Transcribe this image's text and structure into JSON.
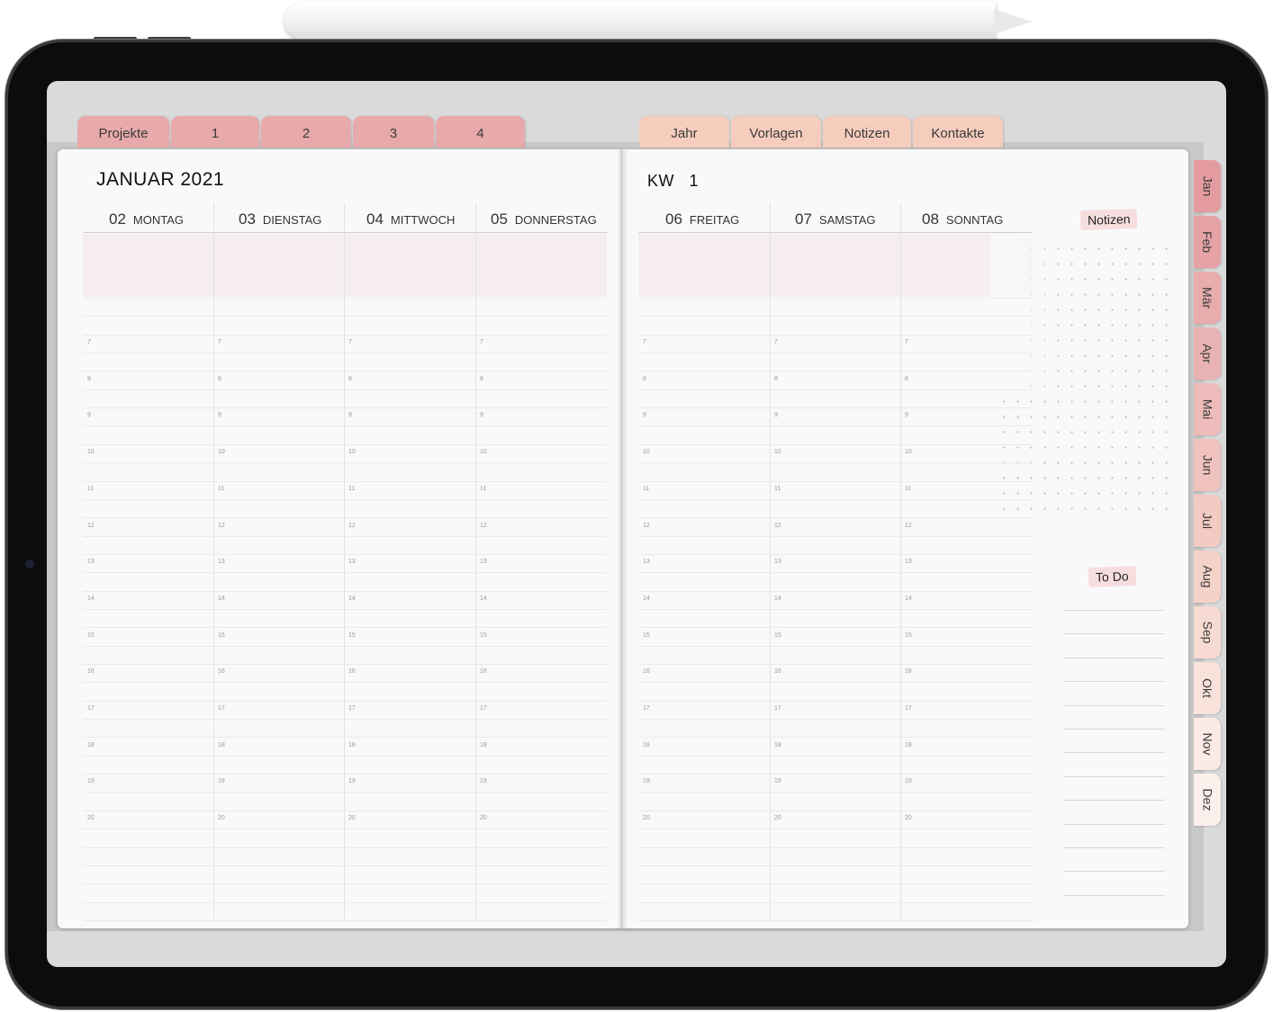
{
  "project_tabs": [
    "Projekte",
    "1",
    "2",
    "3",
    "4"
  ],
  "nav_tabs": [
    "Jahr",
    "Vorlagen",
    "Notizen",
    "Kontakte"
  ],
  "month_tabs": [
    "Jan",
    "Feb",
    "Mär",
    "Apr",
    "Mai",
    "Jun",
    "Jul",
    "Aug",
    "Sep",
    "Okt",
    "Nov",
    "Dez"
  ],
  "colors": {
    "project_tab": "#e8a9ab",
    "nav_tab": "#f6cdbd",
    "sticker": "#f7dede",
    "page": "#f9f9fa"
  },
  "left_page": {
    "title": "JANUAR 2021",
    "days": [
      {
        "num": "02",
        "name": "MONTAG"
      },
      {
        "num": "03",
        "name": "DIENSTAG"
      },
      {
        "num": "04",
        "name": "MITTWOCH"
      },
      {
        "num": "05",
        "name": "DONNERSTAG"
      }
    ]
  },
  "right_page": {
    "week_label": "KW",
    "week_number": "1",
    "days": [
      {
        "num": "06",
        "name": "FREITAG"
      },
      {
        "num": "07",
        "name": "SAMSTAG"
      },
      {
        "num": "08",
        "name": "SONNTAG"
      }
    ],
    "notes_label": "Notizen",
    "todo_label": "To Do"
  },
  "hours": [
    "7",
    "8",
    "9",
    "10",
    "11",
    "12",
    "13",
    "14",
    "15",
    "16",
    "17",
    "18",
    "19",
    "20"
  ]
}
